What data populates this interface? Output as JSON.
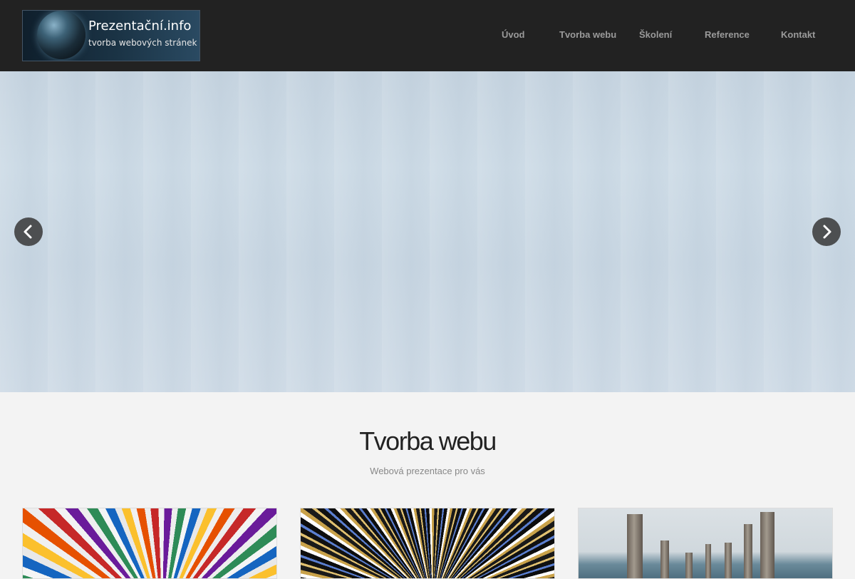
{
  "header": {
    "logo": {
      "title": "Prezentační.info",
      "subtitle": "tvorba webových stránek"
    },
    "nav": [
      {
        "label": "Úvod"
      },
      {
        "label": "Tvorba webu"
      },
      {
        "label": "Školení"
      },
      {
        "label": "Reference"
      },
      {
        "label": "Kontakt"
      }
    ]
  },
  "hero": {
    "prev_icon": "chevron-left-icon",
    "next_icon": "chevron-right-icon"
  },
  "section": {
    "title": "Tvorba webu",
    "subtitle": "Webová prezentace pro vás"
  },
  "cards": [
    {
      "image": "colored-pencils-image"
    },
    {
      "image": "light-streaks-image"
    },
    {
      "image": "sea-posts-image"
    }
  ],
  "colors": {
    "header_bg": "#222222",
    "nav_text": "#9a9a9a",
    "page_bg": "#f3f3f3",
    "title_text": "#222222",
    "subtitle_text": "#888888"
  }
}
